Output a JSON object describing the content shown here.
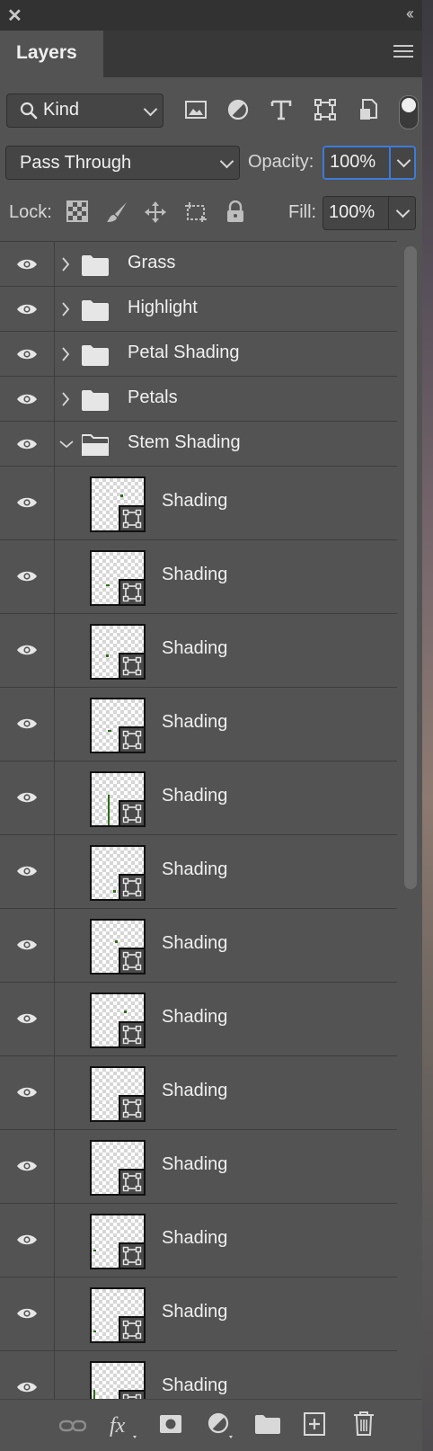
{
  "panel": {
    "tab_label": "Layers",
    "close_icon": "close-icon",
    "collapse_icon": "double-chevron-left-icon",
    "menu_icon": "hamburger-menu-icon"
  },
  "filter": {
    "kind_label": "Kind",
    "icons": [
      "image-filter-icon",
      "adjustment-filter-icon",
      "type-filter-icon",
      "shape-filter-icon",
      "smart-object-filter-icon"
    ],
    "toggle_on": true
  },
  "blend": {
    "mode": "Pass Through",
    "opacity_label": "Opacity:",
    "opacity_value": "100%"
  },
  "lock": {
    "label": "Lock:",
    "fill_label": "Fill:",
    "fill_value": "100%"
  },
  "layers": {
    "groups": [
      {
        "name": "Grass",
        "expanded": false
      },
      {
        "name": "Highlight",
        "expanded": false
      },
      {
        "name": "Petal Shading",
        "expanded": false
      },
      {
        "name": "Petals",
        "expanded": false
      },
      {
        "name": "Stem Shading",
        "expanded": true
      }
    ],
    "children": [
      {
        "name": "Shading"
      },
      {
        "name": "Shading"
      },
      {
        "name": "Shading"
      },
      {
        "name": "Shading"
      },
      {
        "name": "Shading"
      },
      {
        "name": "Shading"
      },
      {
        "name": "Shading"
      },
      {
        "name": "Shading"
      },
      {
        "name": "Shading"
      },
      {
        "name": "Shading"
      },
      {
        "name": "Shading"
      },
      {
        "name": "Shading"
      },
      {
        "name": "Shading"
      }
    ]
  },
  "bottom_icons": [
    "link-layers-icon",
    "fx-icon",
    "layer-mask-icon",
    "adjustment-layer-icon",
    "new-group-icon",
    "new-layer-icon",
    "delete-icon"
  ],
  "colors": {
    "panel_bg": "#535353",
    "focus_border": "#3d7bd6",
    "thumbnail_mark": "#2f6a1a"
  }
}
